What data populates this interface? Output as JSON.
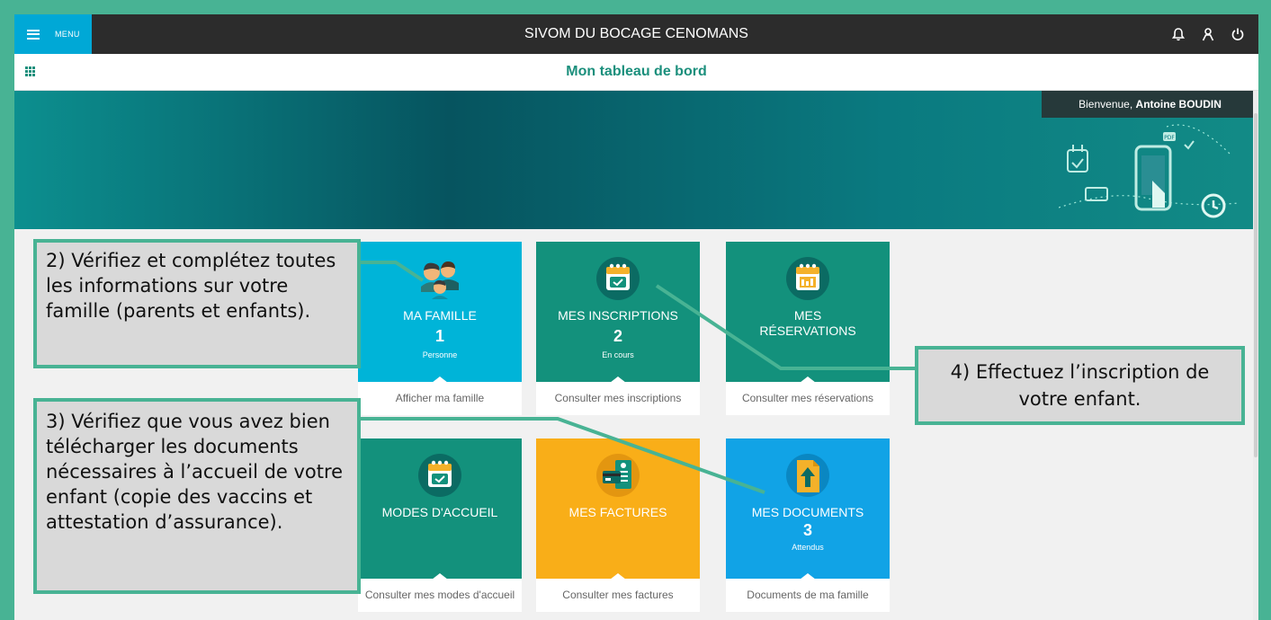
{
  "app": {
    "title": "SIVOM DU BOCAGE CENOMANS",
    "menu_label": "MENU"
  },
  "topbar_icons": [
    "notifications-bell-icon",
    "user-profile-icon",
    "power-logout-icon"
  ],
  "subheader": {
    "title": "Mon tableau de bord"
  },
  "banner": {
    "welcome_prefix": "Bienvenue,",
    "user_name": "Antoine BOUDIN",
    "badge_pdf": "PDF"
  },
  "tiles": [
    {
      "title": "MA FAMILLE",
      "count": "1",
      "sub": "Personne",
      "link": "Afficher ma famille",
      "color": "#00b4d8",
      "icon": "family-icon"
    },
    {
      "title": "MES INSCRIPTIONS",
      "count": "2",
      "sub": "En cours",
      "link": "Consulter mes inscriptions",
      "color": "#13917c",
      "icon": "calendar-check-icon"
    },
    {
      "title_line1": "MES",
      "title_line2": "RÉSERVATIONS",
      "link": "Consulter mes réservations",
      "color": "#13917c",
      "icon": "calendar-grid-icon"
    },
    {
      "title": "MODES D'ACCUEIL",
      "link": "Consulter mes modes d'accueil",
      "color": "#13917c",
      "icon": "calendar-check-icon"
    },
    {
      "title": "MES FACTURES",
      "link": "Consulter mes factures",
      "color": "#f9ae18",
      "icon": "invoice-card-icon"
    },
    {
      "title": "MES DOCUMENTS",
      "count": "3",
      "sub": "Attendus",
      "link": "Documents de ma famille",
      "color": "#11a3e6",
      "icon": "document-upload-icon"
    }
  ],
  "callouts": {
    "c2": "2) Vérifiez et complétez toutes les informations sur votre famille (parents et enfants).",
    "c3": "3) Vérifiez que vous avez bien télécharger les documents nécessaires à l’accueil de votre enfant (copie des vaccins et attestation d’assurance).",
    "c4": "4) Effectuez l’inscription de votre enfant."
  },
  "colors": {
    "frame": "#48b394",
    "topbar": "#2c2c2c",
    "menu": "#00a8d6",
    "accent": "#1b8f7c",
    "callout_bg": "#d9d9d9"
  }
}
